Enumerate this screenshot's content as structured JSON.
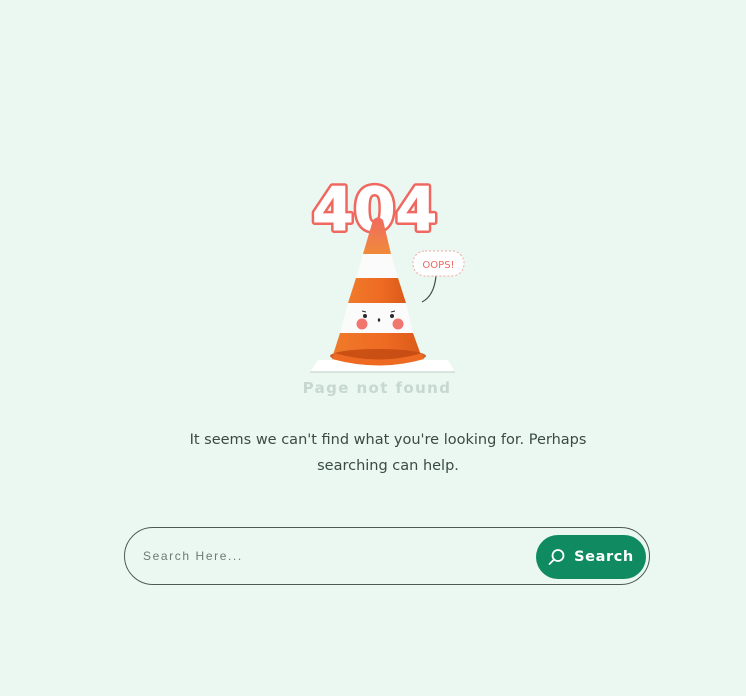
{
  "illustration": {
    "heading_404": "404",
    "speech_bubble": "OOPS!",
    "caption": "Page not found"
  },
  "message": "It seems we can't find what you're looking for. Perhaps searching can help.",
  "search": {
    "placeholder": "Search Here...",
    "value": "",
    "button_label": "Search",
    "button_icon": "search-icon"
  },
  "colors": {
    "background": "#eaf8f1",
    "accent": "#0f8a61",
    "cone_orange": "#ee6a22",
    "coral": "#f0675f",
    "text": "#3b4a44",
    "caption": "#c7d8d0"
  }
}
